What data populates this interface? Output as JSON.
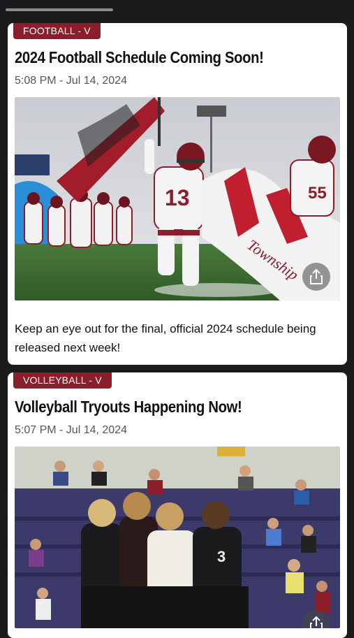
{
  "posts": [
    {
      "category": "FOOTBALL - V",
      "title": "2024 Football Schedule Coming Soon!",
      "meta": "5:08 PM - Jul 14, 2024",
      "body": "Keep an eye out for the final, official 2024 schedule being released next week!",
      "banner_text": "Township"
    },
    {
      "category": "VOLLEYBALL - V",
      "title": "Volleyball Tryouts Happening Now!",
      "meta": "5:07 PM - Jul 14, 2024"
    }
  ],
  "colors": {
    "accent": "#8c1d2b",
    "background": "#1b1b1d",
    "card": "#ffffff"
  },
  "icons": {
    "share": "share-icon"
  }
}
